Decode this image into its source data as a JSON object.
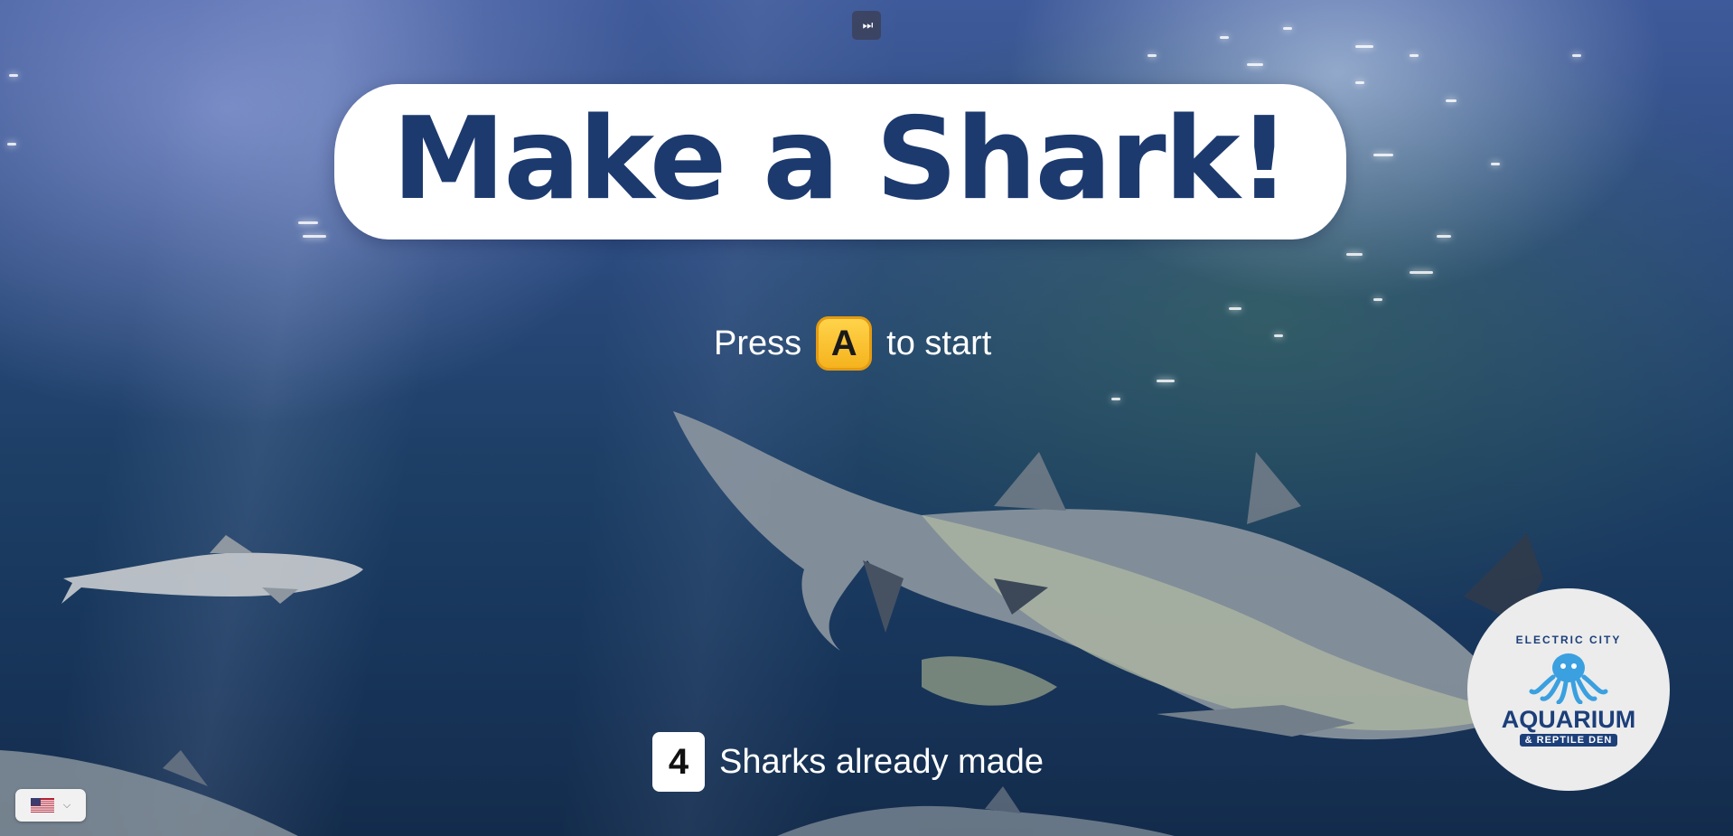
{
  "controls": {
    "skip_glyph": "⏭"
  },
  "title": {
    "text": "Make a Shark!"
  },
  "start_prompt": {
    "prefix": "Press",
    "key": "A",
    "suffix": "to start"
  },
  "counter": {
    "count": "4",
    "label": "Sharks already made"
  },
  "logo": {
    "arc_text": "ELECTRIC CITY",
    "main_text": "AQUARIUM",
    "sub_text": "& REPTILE DEN",
    "colors": {
      "primary": "#1c3f7a",
      "accent": "#3aa0e0"
    }
  },
  "language": {
    "flag_icon": "us-flag-icon",
    "chevron_icon": "chevron-down-icon"
  },
  "colors": {
    "title": "#1d3a6f",
    "key_badge": "#f5b31e"
  }
}
